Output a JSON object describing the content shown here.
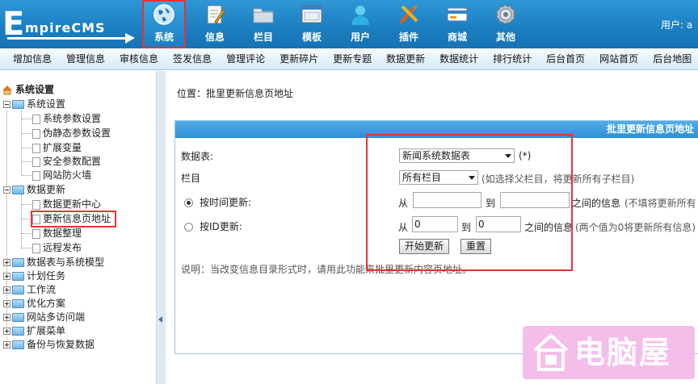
{
  "header": {
    "logo_big": "E",
    "logo_rest": "mpireCMS",
    "nav": [
      {
        "label": "系统",
        "icon": "globe-icon",
        "active": true
      },
      {
        "label": "信息",
        "icon": "document-pen-icon"
      },
      {
        "label": "栏目",
        "icon": "folder-icon"
      },
      {
        "label": "模板",
        "icon": "window-icon"
      },
      {
        "label": "用户",
        "icon": "user-icon"
      },
      {
        "label": "插件",
        "icon": "tools-icon"
      },
      {
        "label": "商城",
        "icon": "card-icon"
      },
      {
        "label": "其他",
        "icon": "gear-icon"
      }
    ],
    "user_label": "用户: a"
  },
  "subnav": [
    "增加信息",
    "管理信息",
    "审核信息",
    "签发信息",
    "管理评论",
    "更新碎片",
    "更新专题",
    "数据更新",
    "数据统计",
    "排行统计",
    "后台首页",
    "网站首页",
    "后台地图"
  ],
  "sidebar": {
    "root": "系统设置",
    "groups": [
      {
        "label": "系统设置",
        "expanded": true,
        "children": [
          "系统参数设置",
          "伪静态参数设置",
          "扩展变量",
          "安全参数配置",
          "网站防火墙"
        ]
      },
      {
        "label": "数据更新",
        "expanded": true,
        "children": [
          "数据更新中心",
          "更新信息页地址",
          "数据整理",
          "远程发布"
        ]
      },
      {
        "label": "数据表与系统模型",
        "expanded": false
      },
      {
        "label": "计划任务",
        "expanded": false
      },
      {
        "label": "工作流",
        "expanded": false
      },
      {
        "label": "优化方案",
        "expanded": false
      },
      {
        "label": "网站多访问端",
        "expanded": false
      },
      {
        "label": "扩展菜单",
        "expanded": false
      },
      {
        "label": "备份与恢复数据",
        "expanded": false
      }
    ]
  },
  "content": {
    "location": "位置：批里更新信息页地址",
    "panel_title": "批里更新信息页地址",
    "table_label": "数据表:",
    "table_value": "新闻系统数据表",
    "table_suffix": "(*)",
    "column_label": "栏目",
    "column_value": "所有栏目",
    "column_hint": "(如选择父栏目，将更新所有子栏目)",
    "by_time_label": "按时间更新:",
    "by_time_from": "从",
    "by_time_to": "到",
    "by_time_between": "之间的信息",
    "by_time_hint": "(不填将更新所有",
    "by_time_start": "",
    "by_time_end": "",
    "by_id_label": "按ID更新:",
    "by_id_from": "从",
    "by_id_to": "到",
    "by_id_between": "之间的信息",
    "by_id_hint": "(两个值为0将更新所有信息)",
    "by_id_start": "0",
    "by_id_end": "0",
    "submit_label": "开始更新",
    "reset_label": "重置",
    "note": "说明：当改变信息目录形式时，请用此功能来批里更新内容页地址。"
  },
  "watermark": {
    "text": "电脑屋"
  },
  "colors": {
    "header_blue": "#1b7ec1",
    "panel_head": "#2e8fd4",
    "highlight_red": "#e83333",
    "subnav_bg": "#d6eaf8"
  }
}
